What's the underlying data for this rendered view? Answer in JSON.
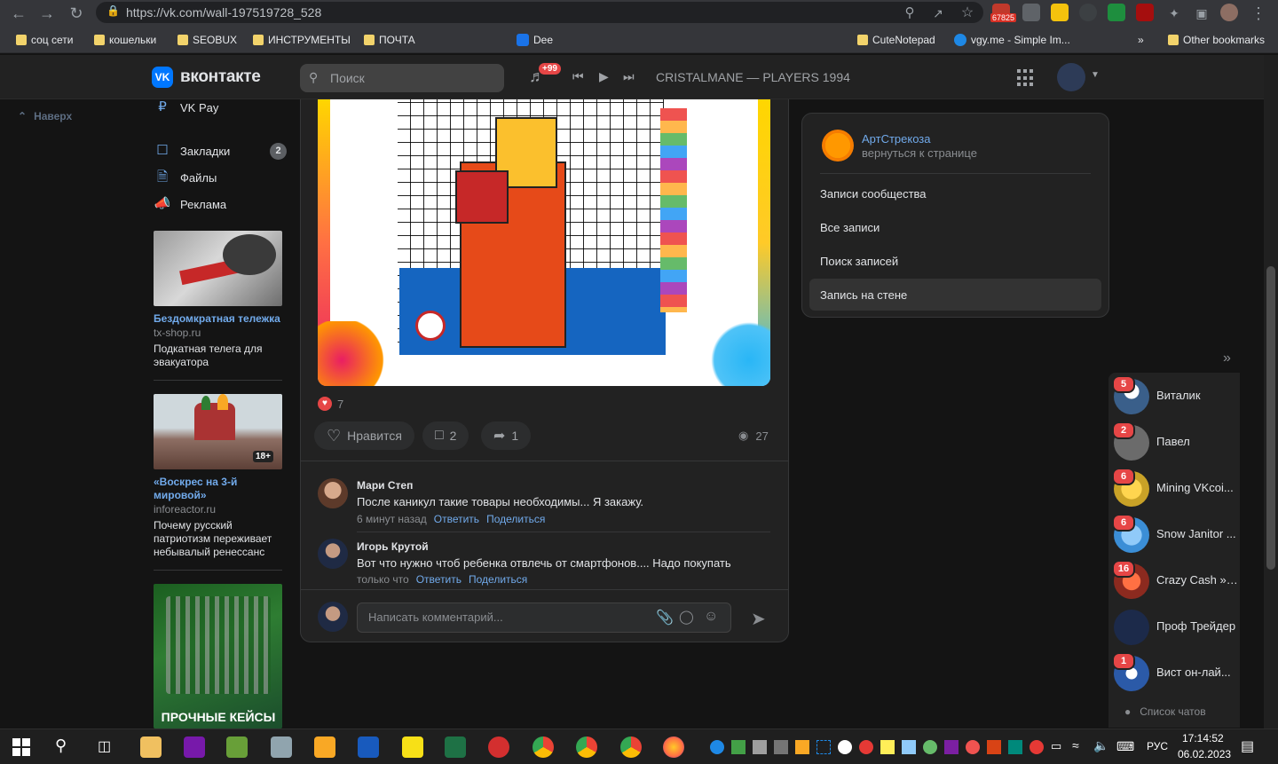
{
  "browser": {
    "url": "https://vk.com/wall-197519728_528",
    "mail_count": "67825",
    "bookmarks": [
      {
        "label": "соц сети",
        "type": "folder"
      },
      {
        "label": "кошельки",
        "type": "folder"
      },
      {
        "label": "SEOBUX",
        "type": "folder"
      },
      {
        "label": "ИНСТРУМЕНТЫ",
        "type": "folder"
      },
      {
        "label": "ПОЧТА",
        "type": "folder"
      },
      {
        "label": "Dee",
        "type": "site"
      },
      {
        "label": "CuteNotepad",
        "type": "folder"
      },
      {
        "label": "vgy.me - Simple Im...",
        "type": "site"
      }
    ],
    "other_bookmarks": "Other bookmarks",
    "more_bookmarks": "»"
  },
  "vk": {
    "logo_text": "вконтакте",
    "search_placeholder": "Поиск",
    "notifications_badge": "+99",
    "now_playing": "CRISTALMANE — PLAYERS 1994",
    "back_to_top": "Наверх"
  },
  "leftnav": [
    {
      "label": "VK Pay",
      "icon": "vkpay-icon"
    },
    {
      "label": "Закладки",
      "icon": "bookmark-icon",
      "badge": "2"
    },
    {
      "label": "Файлы",
      "icon": "file-icon"
    },
    {
      "label": "Реклама",
      "icon": "megaphone-icon"
    }
  ],
  "ads": [
    {
      "title": "Бездомкратная тележка",
      "domain": "tx-shop.ru",
      "text": "Подкатная телега для эвакуатора"
    },
    {
      "title": "«Воскрес на 3-й мировой»",
      "domain": "inforeactor.ru",
      "text": "Почему русский патриотизм переживает небывалый ренессанс",
      "age": "18+"
    },
    {
      "banner_text": "ПРОЧНЫЕ КЕЙСЫ"
    }
  ],
  "post": {
    "likes_count": "7",
    "like_label": "Нравится",
    "comments_count": "2",
    "shares_count": "1",
    "views": "27",
    "comments": [
      {
        "author": "Мари Степ",
        "text": "После каникул такие товары необходимы... Я закажу.",
        "time": "6 минут назад",
        "reply": "Ответить",
        "share": "Поделиться"
      },
      {
        "author": "Игорь Крутой",
        "text": "Вот что нужно чтоб ребенка отвлечь от смартфонов.... Надо покупать",
        "time": "только что",
        "reply": "Ответить",
        "share": "Поделиться"
      }
    ],
    "comment_placeholder": "Написать комментарий..."
  },
  "rightmenu": {
    "group_name": "АртСтрекоза",
    "group_sub": "вернуться к странице",
    "items": [
      "Записи сообщества",
      "Все записи",
      "Поиск записей",
      "Запись на стене"
    ],
    "active_index": 3
  },
  "chats": {
    "items": [
      {
        "name": "Виталик",
        "badge": "5",
        "color": "#3a5f8a"
      },
      {
        "name": "Павел",
        "badge": "2",
        "color": "#6b6b6b"
      },
      {
        "name": "Mining VKcoi...",
        "badge": "6",
        "color": "#c9a227"
      },
      {
        "name": "Snow Janitor ...",
        "badge": "6",
        "color": "#3b8ed6"
      },
      {
        "name": "Crazy Cash » ...",
        "badge": "16",
        "color": "#8c2a1f"
      },
      {
        "name": "Проф Трейдер",
        "badge": "",
        "color": "#1c2a4a"
      },
      {
        "name": "Вист он-лай...",
        "badge": "1",
        "color": "#2b5aa8"
      }
    ],
    "list_label": "Список чатов"
  },
  "taskbar": {
    "language": "РУС",
    "time": "17:14:52",
    "date": "06.02.2023"
  }
}
